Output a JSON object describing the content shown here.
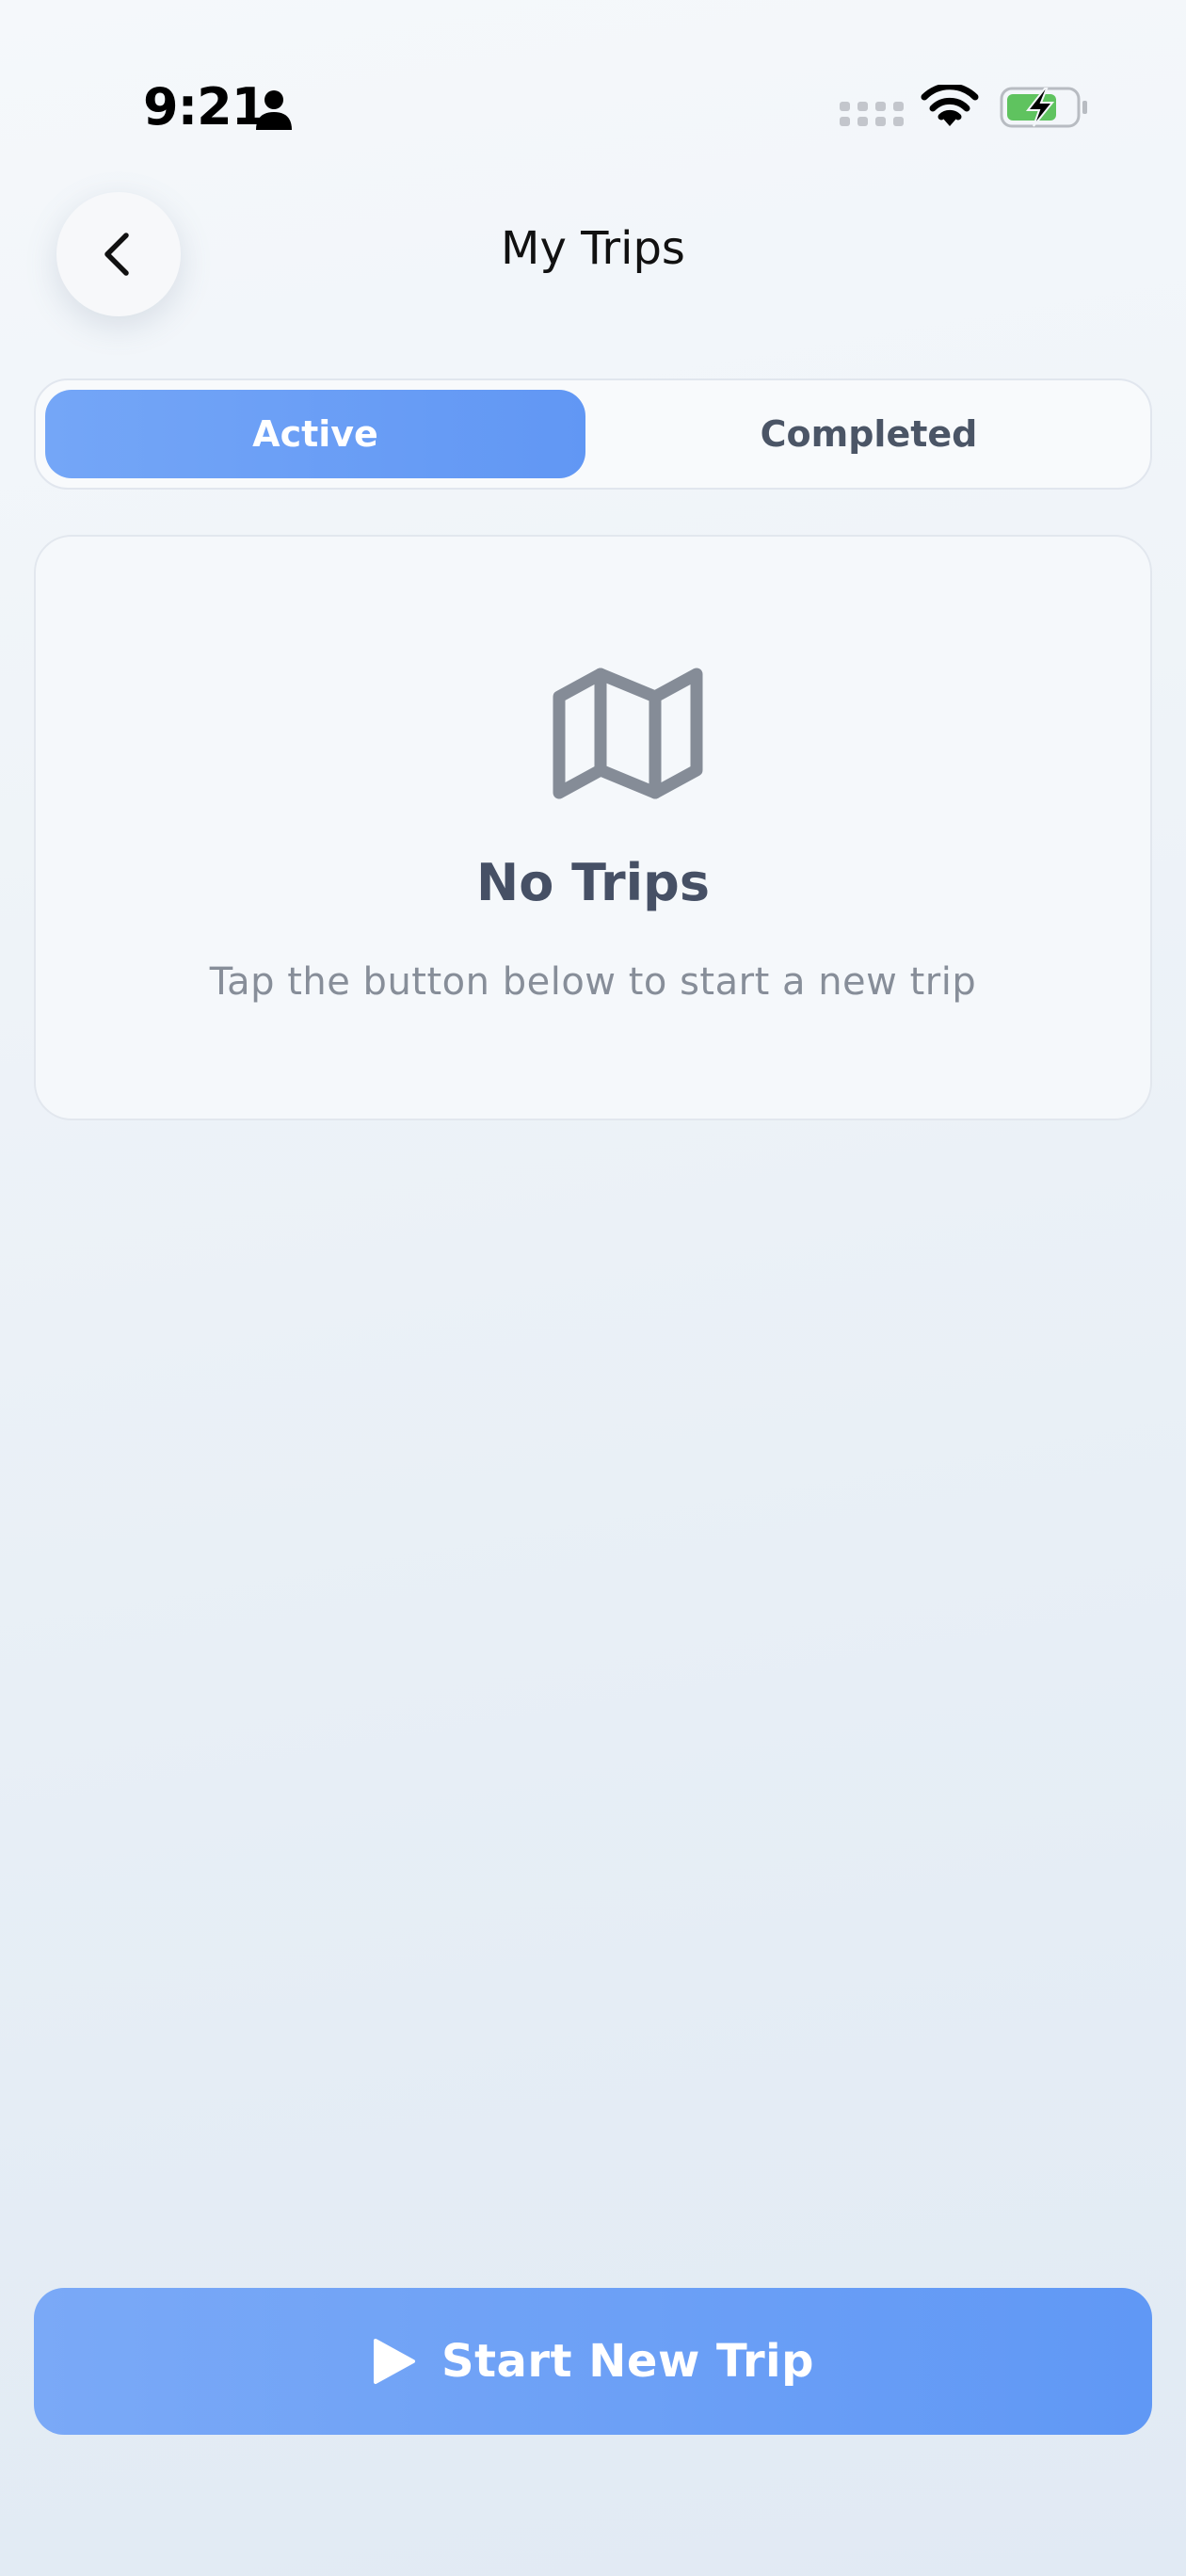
{
  "status_bar": {
    "time": "9:21",
    "icons": [
      "person-icon",
      "signal-icon",
      "wifi-icon",
      "battery-charging-icon"
    ]
  },
  "header": {
    "title": "My Trips",
    "back_icon": "chevron-left-icon"
  },
  "tabs": [
    {
      "label": "Active",
      "selected": true
    },
    {
      "label": "Completed",
      "selected": false
    }
  ],
  "empty_state": {
    "icon": "map-icon",
    "title": "No Trips",
    "subtitle": "Tap the button below to start a new trip"
  },
  "primary_action": {
    "icon": "play-icon",
    "label": "Start New Trip"
  },
  "colors": {
    "accent": "#6a9ef5",
    "battery_fill": "#5fc35f",
    "muted_text": "#878e99",
    "heading_text": "#465065"
  }
}
